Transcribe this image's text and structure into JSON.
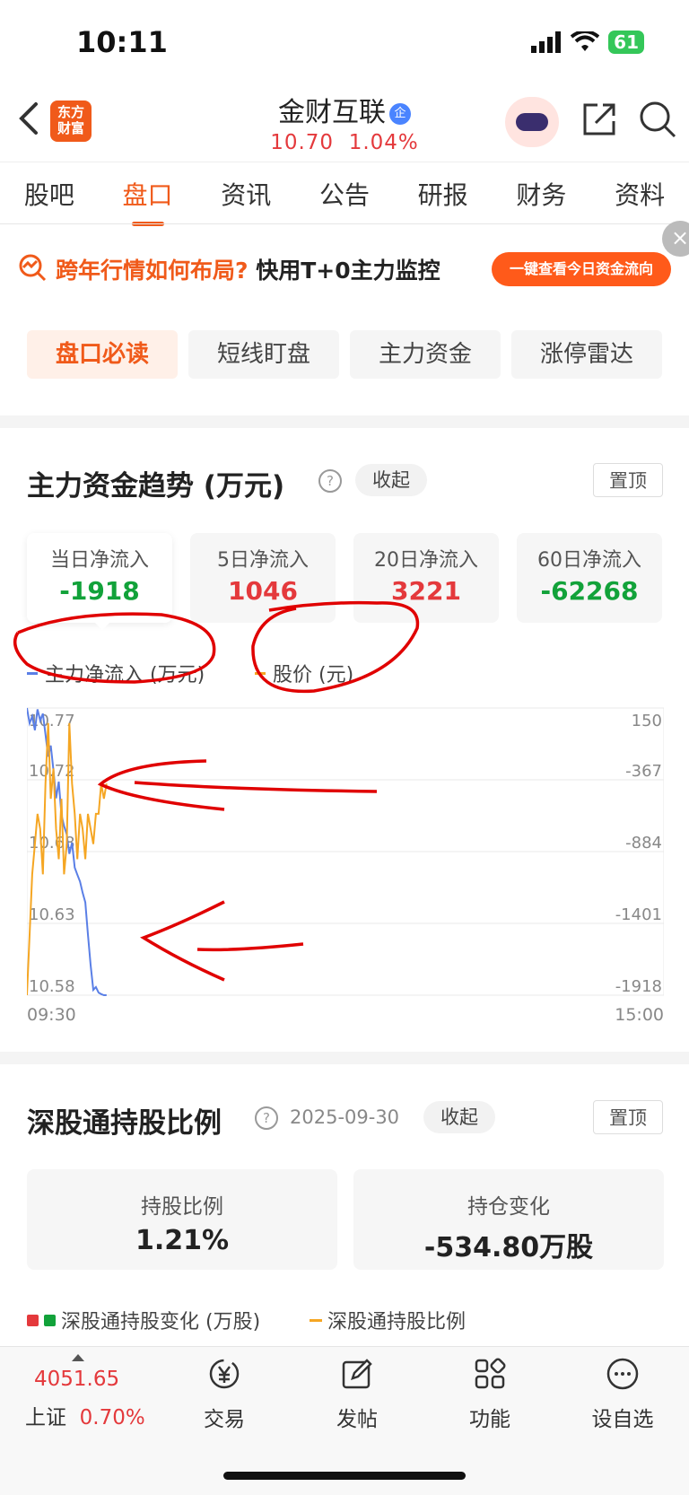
{
  "status": {
    "time": "10:11",
    "battery": "61"
  },
  "header": {
    "logo_line1": "东方",
    "logo_line2": "财富",
    "stock_name": "金财互联",
    "badge": "企",
    "price": "10.70",
    "change": "1.04%"
  },
  "tabs": [
    {
      "label": "股吧"
    },
    {
      "label": "盘口",
      "active": true
    },
    {
      "label": "资讯"
    },
    {
      "label": "公告"
    },
    {
      "label": "研报"
    },
    {
      "label": "财务"
    },
    {
      "label": "资料"
    }
  ],
  "banner": {
    "orange_text": "跨年行情如何布局?",
    "black_text": "快用T+0主力监控",
    "button": "一键查看今日资金流向",
    "close": "×"
  },
  "chips": [
    "盘口必读",
    "短线盯盘",
    "主力资金",
    "涨停雷达"
  ],
  "fund_section": {
    "title": "主力资金趋势 (万元)",
    "help": "?",
    "collapse": "收起",
    "pin": "置顶",
    "cards": [
      {
        "label": "当日净流入",
        "value": "-1918",
        "tone": "green"
      },
      {
        "label": "5日净流入",
        "value": "1046",
        "tone": "red"
      },
      {
        "label": "20日净流入",
        "value": "3221",
        "tone": "red"
      },
      {
        "label": "60日净流入",
        "value": "-62268",
        "tone": "green"
      }
    ],
    "legend": {
      "flow": "主力净流入 (万元)",
      "price": "股价 (元)"
    },
    "colors": {
      "flow": "#5a7fe6",
      "price": "#f5a623",
      "annotation": "#e00000"
    }
  },
  "chart_data": {
    "type": "line",
    "x_start": "09:30",
    "x_end": "15:00",
    "x_range": [
      0,
      240
    ],
    "left_axis": {
      "ticks": [
        "10.77",
        "10.72",
        "10.68",
        "10.63",
        "10.58"
      ],
      "range": [
        10.58,
        10.77
      ]
    },
    "right_axis": {
      "ticks": [
        "150",
        "-367",
        "-884",
        "-1401",
        "-1918"
      ],
      "range": [
        -1918,
        150
      ]
    },
    "series": [
      {
        "name": "主力净流入 (万元)",
        "axis": "right",
        "points": [
          [
            0,
            150
          ],
          [
            1,
            40
          ],
          [
            2,
            90
          ],
          [
            3,
            -10
          ],
          [
            4,
            140
          ],
          [
            5,
            60
          ],
          [
            6,
            110
          ],
          [
            7,
            -40
          ],
          [
            8,
            -200
          ],
          [
            9,
            -120
          ],
          [
            10,
            -300
          ],
          [
            11,
            -500
          ],
          [
            12,
            -380
          ],
          [
            13,
            -620
          ],
          [
            14,
            -700
          ],
          [
            15,
            -760
          ],
          [
            16,
            -900
          ],
          [
            17,
            -820
          ],
          [
            18,
            -1000
          ],
          [
            19,
            -1050
          ],
          [
            20,
            -1100
          ],
          [
            21,
            -1180
          ],
          [
            22,
            -1250
          ],
          [
            23,
            -1480
          ],
          [
            24,
            -1700
          ],
          [
            25,
            -1880
          ],
          [
            26,
            -1860
          ],
          [
            27,
            -1900
          ],
          [
            28,
            -1910
          ],
          [
            29,
            -1918
          ],
          [
            30,
            -1918
          ]
        ]
      },
      {
        "name": "股价 (元)",
        "axis": "left",
        "points": [
          [
            0,
            10.58
          ],
          [
            1,
            10.62
          ],
          [
            2,
            10.66
          ],
          [
            3,
            10.68
          ],
          [
            4,
            10.7
          ],
          [
            5,
            10.69
          ],
          [
            6,
            10.66
          ],
          [
            7,
            10.72
          ],
          [
            8,
            10.76
          ],
          [
            9,
            10.71
          ],
          [
            10,
            10.73
          ],
          [
            11,
            10.69
          ],
          [
            12,
            10.67
          ],
          [
            13,
            10.71
          ],
          [
            14,
            10.66
          ],
          [
            15,
            10.68
          ],
          [
            16,
            10.76
          ],
          [
            17,
            10.72
          ],
          [
            18,
            10.7
          ],
          [
            19,
            10.67
          ],
          [
            20,
            10.7
          ],
          [
            21,
            10.69
          ],
          [
            22,
            10.67
          ],
          [
            23,
            10.7
          ],
          [
            24,
            10.69
          ],
          [
            25,
            10.68
          ],
          [
            26,
            10.7
          ],
          [
            27,
            10.7
          ],
          [
            28,
            10.72
          ],
          [
            29,
            10.71
          ],
          [
            30,
            10.72
          ]
        ]
      }
    ]
  },
  "hold_section": {
    "title": "深股通持股比例",
    "help": "?",
    "date": "2025-09-30",
    "collapse": "收起",
    "pin": "置顶",
    "cards": [
      {
        "label": "持股比例",
        "value": "1.21%"
      },
      {
        "label": "持仓变化",
        "value": "-534.80万股"
      }
    ],
    "legend": {
      "change": "深股通持股变化 (万股)",
      "ratio": "深股通持股比例"
    }
  },
  "bottom_bar": {
    "index_value": "4051.65",
    "index_name": "上证",
    "index_change": "0.70%",
    "items": [
      {
        "label": "交易",
        "icon": "yuan-exchange-icon"
      },
      {
        "label": "发帖",
        "icon": "edit-icon"
      },
      {
        "label": "功能",
        "icon": "grid-icon"
      },
      {
        "label": "设自选",
        "icon": "more-icon"
      }
    ]
  }
}
